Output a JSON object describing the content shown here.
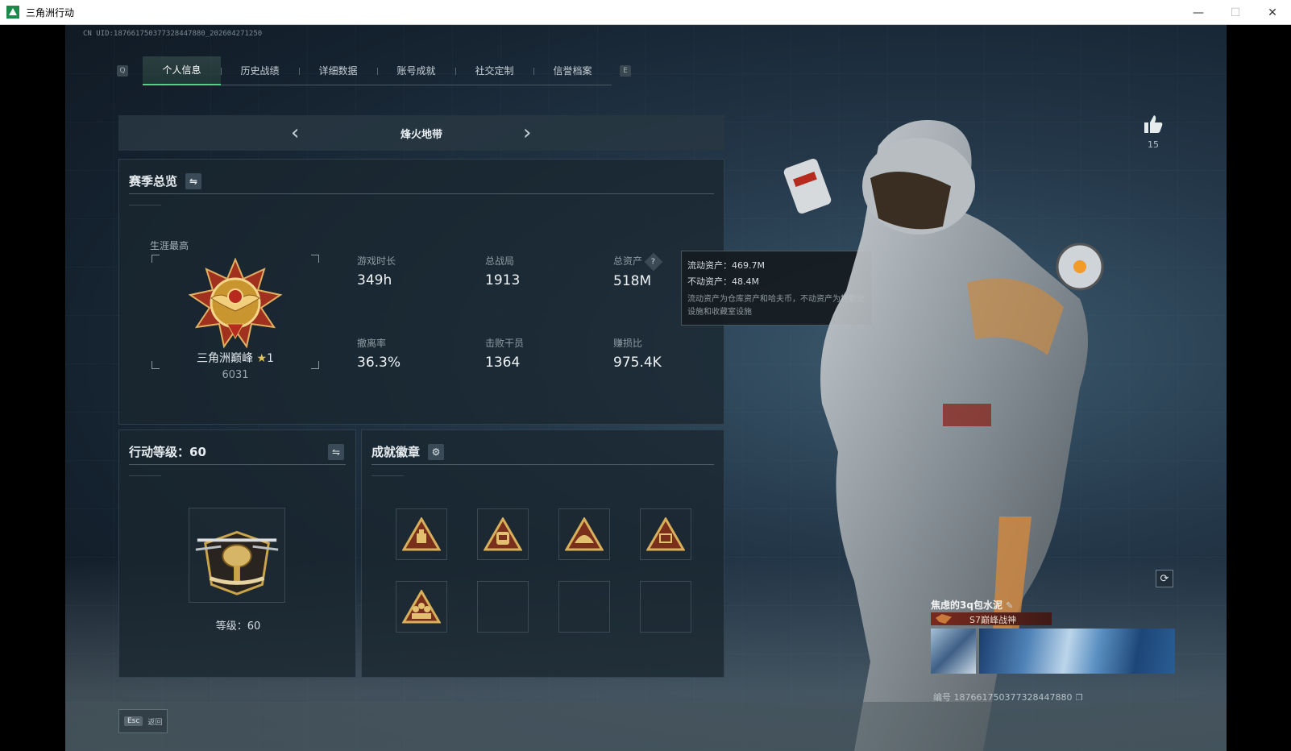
{
  "window": {
    "title": "三角洲行动",
    "minimize": "—",
    "maximize": "☐",
    "close": "✕"
  },
  "uid_line": "CN UID:18766175037732844788​0_202604271250",
  "tabs": {
    "left_key": "Q",
    "right_key": "E",
    "items": [
      {
        "label": "个人信息",
        "active": true
      },
      {
        "label": "历史战绩",
        "active": false
      },
      {
        "label": "详细数据",
        "active": false
      },
      {
        "label": "账号成就",
        "active": false
      },
      {
        "label": "社交定制",
        "active": false
      },
      {
        "label": "信誉档案",
        "active": false
      }
    ]
  },
  "mode": {
    "title": "烽火地带",
    "prev": "‹",
    "next": "›"
  },
  "overview": {
    "title": "赛季总览",
    "swap_icon": "⇋",
    "career_label": "生涯最高",
    "rank_name": "三角洲巅峰",
    "rank_star": "★",
    "rank_level": "1",
    "rank_score": "6031",
    "stats": [
      {
        "label": "游戏时长",
        "value": "349h"
      },
      {
        "label": "总战局",
        "value": "1913"
      },
      {
        "label": "总资产",
        "value": "518M"
      },
      {
        "label": "撤离率",
        "value": "36.3%"
      },
      {
        "label": "击败干员",
        "value": "1364"
      },
      {
        "label": "赚损比",
        "value": "975.4K"
      }
    ],
    "help_icon": "?"
  },
  "tooltip": {
    "liquid": "流动资产：469.7M",
    "fixed": "不动资产：48.4M",
    "note": "流动资产为仓库资产和哈夫币，不动资产为特勤处设施和收藏室设施"
  },
  "level": {
    "title": "行动等级：60",
    "swap_icon": "⇋",
    "text": "等级：60"
  },
  "badges": {
    "title": "成就徽章",
    "settings_icon": "⚙",
    "slots": [
      {
        "filled": true,
        "glyph": "crate"
      },
      {
        "filled": true,
        "glyph": "backpack"
      },
      {
        "filled": true,
        "glyph": "helmet"
      },
      {
        "filled": true,
        "glyph": "58"
      },
      {
        "filled": true,
        "glyph": "group"
      },
      {
        "filled": false
      },
      {
        "filled": false
      },
      {
        "filled": false
      }
    ]
  },
  "social": {
    "like_count": "15",
    "refresh_icon": "⟳"
  },
  "card": {
    "name": "焦虑的3q包水泥",
    "edit_icon": "✎",
    "title": "S7巅峰战神",
    "id": "编号 18766175037732844788​0",
    "copy_icon": "❐"
  },
  "footer": {
    "esc_key": "Esc",
    "esc_label": "返回"
  },
  "colors": {
    "accent": "#4fd18b",
    "gold": "#c9a44a"
  }
}
